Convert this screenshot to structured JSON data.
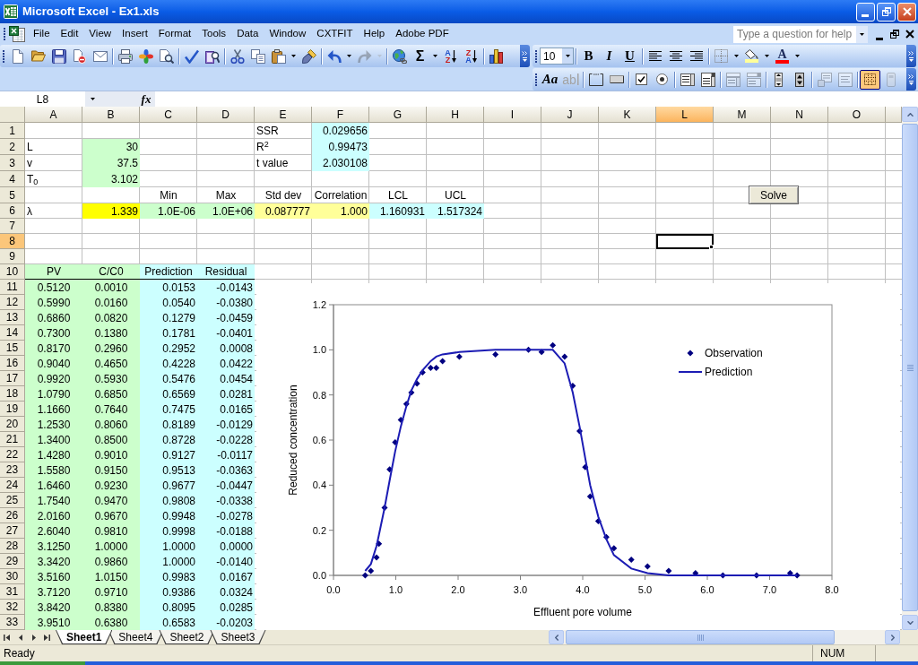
{
  "window": {
    "title": "Microsoft Excel - Ex1.xls"
  },
  "menu_bar": {
    "items": [
      "File",
      "Edit",
      "View",
      "Insert",
      "Format",
      "Tools",
      "Data",
      "Window",
      "CXTFIT",
      "Help",
      "Adobe PDF"
    ],
    "help_box": {
      "placeholder": "Type a question for help"
    }
  },
  "standard_toolbar": {
    "groups": [
      [
        {
          "kind": "new",
          "disabled": false
        },
        {
          "kind": "open",
          "disabled": false
        },
        {
          "kind": "save",
          "disabled": false
        },
        {
          "kind": "permission",
          "disabled": false
        },
        {
          "kind": "email",
          "disabled": false
        }
      ],
      [
        {
          "kind": "print",
          "disabled": false
        },
        {
          "kind": "star",
          "disabled": false
        },
        {
          "kind": "preview",
          "disabled": false
        }
      ],
      [
        {
          "kind": "spelling",
          "disabled": false
        },
        {
          "kind": "research",
          "disabled": false
        }
      ],
      [
        {
          "kind": "cut",
          "disabled": false
        },
        {
          "kind": "copy",
          "disabled": false
        },
        {
          "kind": "paste",
          "disabled": false
        },
        {
          "kind": "caret",
          "disabled": false
        },
        {
          "kind": "format_painter",
          "disabled": false
        }
      ],
      [
        {
          "kind": "undo",
          "disabled": false
        },
        {
          "kind": "caret",
          "disabled": false
        },
        {
          "kind": "redo",
          "disabled": true
        },
        {
          "kind": "caret",
          "disabled": true
        }
      ],
      [
        {
          "kind": "hyperlink",
          "disabled": false
        },
        {
          "kind": "autosum",
          "text": "Σ",
          "disabled": false
        },
        {
          "kind": "caret",
          "disabled": false
        },
        {
          "kind": "sort_ascending",
          "letters": [
            "A",
            "Z"
          ],
          "disabled": false
        },
        {
          "kind": "sort_descending",
          "letters": [
            "Z",
            "A"
          ],
          "disabled": false
        }
      ],
      [
        {
          "kind": "chart_wizard",
          "disabled": false
        }
      ]
    ]
  },
  "formatting_toolbar": {
    "font_size": "10",
    "groups": [
      [
        {
          "kind": "bold",
          "text": "B",
          "disabled": false
        },
        {
          "kind": "italic",
          "text": "I",
          "disabled": false
        },
        {
          "kind": "underline",
          "text": "U",
          "disabled": false
        }
      ],
      [
        {
          "kind": "align_left",
          "disabled": false
        },
        {
          "kind": "align_center",
          "disabled": false
        },
        {
          "kind": "align_right",
          "disabled": false
        }
      ],
      [
        {
          "kind": "borders",
          "disabled": false
        },
        {
          "kind": "caret",
          "disabled": false
        },
        {
          "kind": "fill_color",
          "color": "#ffff99",
          "disabled": false
        },
        {
          "kind": "caret",
          "disabled": false
        },
        {
          "kind": "font_color",
          "text": "A",
          "color": "#ff0000",
          "disabled": false
        },
        {
          "kind": "caret",
          "disabled": false
        }
      ]
    ]
  },
  "forms_toolbar": {
    "groups": [
      [
        {
          "kind": "label",
          "text": "Aa",
          "disabled": false
        },
        {
          "kind": "edit_box",
          "text": "ab",
          "disabled": true
        }
      ],
      [
        {
          "kind": "group_box",
          "disabled": false
        },
        {
          "kind": "push_button",
          "disabled": false
        }
      ],
      [
        {
          "kind": "checkbox",
          "disabled": false
        },
        {
          "kind": "option_button",
          "disabled": false
        }
      ],
      [
        {
          "kind": "list_box",
          "disabled": false
        },
        {
          "kind": "combo_box",
          "disabled": false
        }
      ],
      [
        {
          "kind": "combo_list_edit",
          "disabled": true
        },
        {
          "kind": "combo_drop_edit",
          "disabled": true
        }
      ],
      [
        {
          "kind": "scroll_bar",
          "disabled": false
        },
        {
          "kind": "spinner",
          "disabled": false
        }
      ],
      [
        {
          "kind": "control_properties",
          "disabled": true
        },
        {
          "kind": "edit_code",
          "disabled": true
        }
      ],
      [
        {
          "kind": "toggle_grid",
          "disabled": false,
          "pressed": true
        },
        {
          "kind": "run_dialog",
          "disabled": true
        }
      ]
    ]
  },
  "formula_bar": {
    "name_box": "L8",
    "function_label": "fx"
  },
  "sheet": {
    "columns": [
      {
        "label": "A",
        "selected": false
      },
      {
        "label": "B",
        "selected": false
      },
      {
        "label": "C",
        "selected": false
      },
      {
        "label": "D",
        "selected": false
      },
      {
        "label": "E",
        "selected": false
      },
      {
        "label": "F",
        "selected": false
      },
      {
        "label": "G",
        "selected": false
      },
      {
        "label": "H",
        "selected": false
      },
      {
        "label": "I",
        "selected": false
      },
      {
        "label": "J",
        "selected": false
      },
      {
        "label": "K",
        "selected": false
      },
      {
        "label": "L",
        "selected": true
      },
      {
        "label": "M",
        "selected": false
      },
      {
        "label": "N",
        "selected": false
      },
      {
        "label": "O",
        "selected": false
      }
    ],
    "rows": [
      {
        "header": "1",
        "selected": false,
        "cells": [
          {},
          {},
          {},
          {},
          {
            "text": "SSR",
            "kind": "text"
          },
          {
            "text": "0.029656",
            "kind": "number",
            "color": "#ccffff"
          }
        ]
      },
      {
        "header": "2",
        "selected": false,
        "cells": [
          {
            "text": "L",
            "kind": "text"
          },
          {
            "text": "30",
            "kind": "number",
            "color": "#ccffcc"
          },
          {},
          {},
          {
            "text": "R$^{2}$",
            "kind": "text"
          },
          {
            "text": "0.99473",
            "kind": "number",
            "color": "#ccffff"
          }
        ]
      },
      {
        "header": "3",
        "selected": false,
        "cells": [
          {
            "text": "v",
            "kind": "text"
          },
          {
            "text": "37.5",
            "kind": "number",
            "color": "#ccffcc"
          },
          {},
          {},
          {
            "text": "t value",
            "kind": "text"
          },
          {
            "text": "2.030108",
            "kind": "number",
            "color": "#ccffff"
          }
        ]
      },
      {
        "header": "4",
        "selected": false,
        "cells": [
          {
            "text": "T$_{0}$",
            "kind": "text"
          },
          {
            "text": "3.102",
            "kind": "number",
            "color": "#ccffcc"
          }
        ]
      },
      {
        "header": "5",
        "selected": false,
        "cells": [
          {},
          {},
          {
            "text": "Min",
            "kind": "center"
          },
          {
            "text": "Max",
            "kind": "center"
          },
          {
            "text": "Std dev",
            "kind": "center"
          },
          {
            "text": "Correlation",
            "kind": "center"
          },
          {
            "text": "LCL",
            "kind": "center"
          },
          {
            "text": "UCL",
            "kind": "center"
          }
        ]
      },
      {
        "header": "6",
        "selected": false,
        "cells": [
          {
            "text": "λ",
            "kind": "text"
          },
          {
            "text": "1.339",
            "kind": "number",
            "color": "#ffff00"
          },
          {
            "text": "1.0E-06",
            "kind": "number",
            "color": "#ccffcc"
          },
          {
            "text": "1.0E+06",
            "kind": "number",
            "color": "#ccffcc"
          },
          {
            "text": "0.087777",
            "kind": "number",
            "color": "#ffff99"
          },
          {
            "text": "1.000",
            "kind": "number",
            "color": "#ffff99"
          },
          {
            "text": "1.160931",
            "kind": "number",
            "color": "#ccffff"
          },
          {
            "text": "1.517324",
            "kind": "number",
            "color": "#ccffff"
          }
        ]
      },
      {
        "header": "7",
        "selected": false
      },
      {
        "header": "8",
        "selected": true
      },
      {
        "header": "9",
        "selected": false
      },
      {
        "header": "10",
        "selected": false,
        "cells": [
          {
            "text": "PV",
            "kind": "heading",
            "color": "#ccffcc"
          },
          {
            "text": "C/C0",
            "kind": "heading",
            "color": "#ccffcc"
          },
          {
            "text": "Prediction",
            "kind": "heading",
            "color": "#ccffff"
          },
          {
            "text": "Residual",
            "kind": "heading",
            "color": "#ccffff"
          }
        ]
      },
      {
        "header": "11",
        "selected": false,
        "cells": [
          {
            "text": "0.5120",
            "kind": "center",
            "color": "#ccffcc"
          },
          {
            "text": "0.0010",
            "kind": "center",
            "color": "#ccffcc"
          },
          {
            "text": "0.0153",
            "kind": "number",
            "color": "#ccffff"
          },
          {
            "text": "-0.0143",
            "kind": "number",
            "color": "#ccffff"
          }
        ]
      },
      {
        "header": "12",
        "selected": false,
        "cells": [
          {
            "text": "0.5990",
            "kind": "center",
            "color": "#ccffcc"
          },
          {
            "text": "0.0160",
            "kind": "center",
            "color": "#ccffcc"
          },
          {
            "text": "0.0540",
            "kind": "number",
            "color": "#ccffff"
          },
          {
            "text": "-0.0380",
            "kind": "number",
            "color": "#ccffff"
          }
        ]
      },
      {
        "header": "13",
        "selected": false,
        "cells": [
          {
            "text": "0.6860",
            "kind": "center",
            "color": "#ccffcc"
          },
          {
            "text": "0.0820",
            "kind": "center",
            "color": "#ccffcc"
          },
          {
            "text": "0.1279",
            "kind": "number",
            "color": "#ccffff"
          },
          {
            "text": "-0.0459",
            "kind": "number",
            "color": "#ccffff"
          }
        ]
      },
      {
        "header": "14",
        "selected": false,
        "cells": [
          {
            "text": "0.7300",
            "kind": "center",
            "color": "#ccffcc"
          },
          {
            "text": "0.1380",
            "kind": "center",
            "color": "#ccffcc"
          },
          {
            "text": "0.1781",
            "kind": "number",
            "color": "#ccffff"
          },
          {
            "text": "-0.0401",
            "kind": "number",
            "color": "#ccffff"
          }
        ]
      },
      {
        "header": "15",
        "selected": false,
        "cells": [
          {
            "text": "0.8170",
            "kind": "center",
            "color": "#ccffcc"
          },
          {
            "text": "0.2960",
            "kind": "center",
            "color": "#ccffcc"
          },
          {
            "text": "0.2952",
            "kind": "number",
            "color": "#ccffff"
          },
          {
            "text": "0.0008",
            "kind": "number",
            "color": "#ccffff"
          }
        ]
      },
      {
        "header": "16",
        "selected": false,
        "cells": [
          {
            "text": "0.9040",
            "kind": "center",
            "color": "#ccffcc"
          },
          {
            "text": "0.4650",
            "kind": "center",
            "color": "#ccffcc"
          },
          {
            "text": "0.4228",
            "kind": "number",
            "color": "#ccffff"
          },
          {
            "text": "0.0422",
            "kind": "number",
            "color": "#ccffff"
          }
        ]
      },
      {
        "header": "17",
        "selected": false,
        "cells": [
          {
            "text": "0.9920",
            "kind": "center",
            "color": "#ccffcc"
          },
          {
            "text": "0.5930",
            "kind": "center",
            "color": "#ccffcc"
          },
          {
            "text": "0.5476",
            "kind": "number",
            "color": "#ccffff"
          },
          {
            "text": "0.0454",
            "kind": "number",
            "color": "#ccffff"
          }
        ]
      },
      {
        "header": "18",
        "selected": false,
        "cells": [
          {
            "text": "1.0790",
            "kind": "center",
            "color": "#ccffcc"
          },
          {
            "text": "0.6850",
            "kind": "center",
            "color": "#ccffcc"
          },
          {
            "text": "0.6569",
            "kind": "number",
            "color": "#ccffff"
          },
          {
            "text": "0.0281",
            "kind": "number",
            "color": "#ccffff"
          }
        ]
      },
      {
        "header": "19",
        "selected": false,
        "cells": [
          {
            "text": "1.1660",
            "kind": "center",
            "color": "#ccffcc"
          },
          {
            "text": "0.7640",
            "kind": "center",
            "color": "#ccffcc"
          },
          {
            "text": "0.7475",
            "kind": "number",
            "color": "#ccffff"
          },
          {
            "text": "0.0165",
            "kind": "number",
            "color": "#ccffff"
          }
        ]
      },
      {
        "header": "20",
        "selected": false,
        "cells": [
          {
            "text": "1.2530",
            "kind": "center",
            "color": "#ccffcc"
          },
          {
            "text": "0.8060",
            "kind": "center",
            "color": "#ccffcc"
          },
          {
            "text": "0.8189",
            "kind": "number",
            "color": "#ccffff"
          },
          {
            "text": "-0.0129",
            "kind": "number",
            "color": "#ccffff"
          }
        ]
      },
      {
        "header": "21",
        "selected": false,
        "cells": [
          {
            "text": "1.3400",
            "kind": "center",
            "color": "#ccffcc"
          },
          {
            "text": "0.8500",
            "kind": "center",
            "color": "#ccffcc"
          },
          {
            "text": "0.8728",
            "kind": "number",
            "color": "#ccffff"
          },
          {
            "text": "-0.0228",
            "kind": "number",
            "color": "#ccffff"
          }
        ]
      },
      {
        "header": "22",
        "selected": false,
        "cells": [
          {
            "text": "1.4280",
            "kind": "center",
            "color": "#ccffcc"
          },
          {
            "text": "0.9010",
            "kind": "center",
            "color": "#ccffcc"
          },
          {
            "text": "0.9127",
            "kind": "number",
            "color": "#ccffff"
          },
          {
            "text": "-0.0117",
            "kind": "number",
            "color": "#ccffff"
          }
        ]
      },
      {
        "header": "23",
        "selected": false,
        "cells": [
          {
            "text": "1.5580",
            "kind": "center",
            "color": "#ccffcc"
          },
          {
            "text": "0.9150",
            "kind": "center",
            "color": "#ccffcc"
          },
          {
            "text": "0.9513",
            "kind": "number",
            "color": "#ccffff"
          },
          {
            "text": "-0.0363",
            "kind": "number",
            "color": "#ccffff"
          }
        ]
      },
      {
        "header": "24",
        "selected": false,
        "cells": [
          {
            "text": "1.6460",
            "kind": "center",
            "color": "#ccffcc"
          },
          {
            "text": "0.9230",
            "kind": "center",
            "color": "#ccffcc"
          },
          {
            "text": "0.9677",
            "kind": "number",
            "color": "#ccffff"
          },
          {
            "text": "-0.0447",
            "kind": "number",
            "color": "#ccffff"
          }
        ]
      },
      {
        "header": "25",
        "selected": false,
        "cells": [
          {
            "text": "1.7540",
            "kind": "center",
            "color": "#ccffcc"
          },
          {
            "text": "0.9470",
            "kind": "center",
            "color": "#ccffcc"
          },
          {
            "text": "0.9808",
            "kind": "number",
            "color": "#ccffff"
          },
          {
            "text": "-0.0338",
            "kind": "number",
            "color": "#ccffff"
          }
        ]
      },
      {
        "header": "26",
        "selected": false,
        "cells": [
          {
            "text": "2.0160",
            "kind": "center",
            "color": "#ccffcc"
          },
          {
            "text": "0.9670",
            "kind": "center",
            "color": "#ccffcc"
          },
          {
            "text": "0.9948",
            "kind": "number",
            "color": "#ccffff"
          },
          {
            "text": "-0.0278",
            "kind": "number",
            "color": "#ccffff"
          }
        ]
      },
      {
        "header": "27",
        "selected": false,
        "cells": [
          {
            "text": "2.6040",
            "kind": "center",
            "color": "#ccffcc"
          },
          {
            "text": "0.9810",
            "kind": "center",
            "color": "#ccffcc"
          },
          {
            "text": "0.9998",
            "kind": "number",
            "color": "#ccffff"
          },
          {
            "text": "-0.0188",
            "kind": "number",
            "color": "#ccffff"
          }
        ]
      },
      {
        "header": "28",
        "selected": false,
        "cells": [
          {
            "text": "3.1250",
            "kind": "center",
            "color": "#ccffcc"
          },
          {
            "text": "1.0000",
            "kind": "center",
            "color": "#ccffcc"
          },
          {
            "text": "1.0000",
            "kind": "number",
            "color": "#ccffff"
          },
          {
            "text": "0.0000",
            "kind": "number",
            "color": "#ccffff"
          }
        ]
      },
      {
        "header": "29",
        "selected": false,
        "cells": [
          {
            "text": "3.3420",
            "kind": "center",
            "color": "#ccffcc"
          },
          {
            "text": "0.9860",
            "kind": "center",
            "color": "#ccffcc"
          },
          {
            "text": "1.0000",
            "kind": "number",
            "color": "#ccffff"
          },
          {
            "text": "-0.0140",
            "kind": "number",
            "color": "#ccffff"
          }
        ]
      },
      {
        "header": "30",
        "selected": false,
        "cells": [
          {
            "text": "3.5160",
            "kind": "center",
            "color": "#ccffcc"
          },
          {
            "text": "1.0150",
            "kind": "center",
            "color": "#ccffcc"
          },
          {
            "text": "0.9983",
            "kind": "number",
            "color": "#ccffff"
          },
          {
            "text": "0.0167",
            "kind": "number",
            "color": "#ccffff"
          }
        ]
      },
      {
        "header": "31",
        "selected": false,
        "cells": [
          {
            "text": "3.7120",
            "kind": "center",
            "color": "#ccffcc"
          },
          {
            "text": "0.9710",
            "kind": "center",
            "color": "#ccffcc"
          },
          {
            "text": "0.9386",
            "kind": "number",
            "color": "#ccffff"
          },
          {
            "text": "0.0324",
            "kind": "number",
            "color": "#ccffff"
          }
        ]
      },
      {
        "header": "32",
        "selected": false,
        "cells": [
          {
            "text": "3.8420",
            "kind": "center",
            "color": "#ccffcc"
          },
          {
            "text": "0.8380",
            "kind": "center",
            "color": "#ccffcc"
          },
          {
            "text": "0.8095",
            "kind": "number",
            "color": "#ccffff"
          },
          {
            "text": "0.0285",
            "kind": "number",
            "color": "#ccffff"
          }
        ]
      },
      {
        "header": "33",
        "selected": false,
        "cells": [
          {
            "text": "3.9510",
            "kind": "center",
            "color": "#ccffcc"
          },
          {
            "text": "0.6380",
            "kind": "center",
            "color": "#ccffcc"
          },
          {
            "text": "0.6583",
            "kind": "number",
            "color": "#ccffff"
          },
          {
            "text": "-0.0203",
            "kind": "number",
            "color": "#ccffff"
          }
        ]
      }
    ]
  },
  "solve_button": {
    "label": "Solve"
  },
  "chart": {
    "chart_data": {
      "type": "scatter",
      "xlabel": "Effluent pore volume",
      "ylabel": "Reduced concentration",
      "x": [
        0.51,
        0.6,
        0.69,
        0.73,
        0.82,
        0.9,
        0.99,
        1.08,
        1.17,
        1.25,
        1.34,
        1.43,
        1.56,
        1.65,
        1.75,
        2.02,
        2.6,
        3.13,
        3.34,
        3.52,
        3.71,
        3.84,
        3.95,
        4.04,
        4.12,
        4.25,
        4.38,
        4.5,
        4.78,
        5.04,
        5.38,
        5.81,
        6.25,
        6.79,
        7.33,
        7.44
      ],
      "series": [
        {
          "name": "Observation",
          "type": "scatter",
          "color": "#000080",
          "values": [
            0.0,
            0.02,
            0.08,
            0.14,
            0.3,
            0.47,
            0.59,
            0.69,
            0.76,
            0.81,
            0.85,
            0.9,
            0.92,
            0.92,
            0.95,
            0.97,
            0.98,
            1.0,
            0.99,
            1.02,
            0.97,
            0.84,
            0.64,
            0.48,
            0.35,
            0.24,
            0.17,
            0.12,
            0.07,
            0.04,
            0.02,
            0.01,
            0.0,
            0.0,
            0.01,
            0.0
          ]
        },
        {
          "name": "Prediction",
          "type": "line",
          "color": "#1c1cb4",
          "values": [
            0.02,
            0.05,
            0.13,
            0.18,
            0.3,
            0.42,
            0.55,
            0.66,
            0.75,
            0.82,
            0.87,
            0.91,
            0.95,
            0.97,
            0.98,
            0.99,
            1.0,
            1.0,
            1.0,
            1.0,
            0.94,
            0.81,
            0.66,
            0.52,
            0.4,
            0.26,
            0.16,
            0.09,
            0.03,
            0.01,
            0.0,
            0.0,
            0.0,
            0.0,
            0.0,
            0.0
          ]
        }
      ],
      "xlim": [
        0,
        8
      ],
      "ylim": [
        0,
        1.2
      ],
      "xticks": [
        {
          "value": 0,
          "label": "0.0"
        },
        {
          "value": 1,
          "label": "1.0"
        },
        {
          "value": 2,
          "label": "2.0"
        },
        {
          "value": 3,
          "label": "3.0"
        },
        {
          "value": 4,
          "label": "4.0"
        },
        {
          "value": 5,
          "label": "5.0"
        },
        {
          "value": 6,
          "label": "6.0"
        },
        {
          "value": 7,
          "label": "7.0"
        },
        {
          "value": 8,
          "label": "8.0"
        }
      ],
      "yticks": [
        {
          "value": 0,
          "label": "0.0"
        },
        {
          "value": 0.2,
          "label": "0.2"
        },
        {
          "value": 0.4,
          "label": "0.4"
        },
        {
          "value": 0.6,
          "label": "0.6"
        },
        {
          "value": 0.8,
          "label": "0.8"
        },
        {
          "value": 1.0,
          "label": "1.0"
        },
        {
          "value": 1.2,
          "label": "1.2"
        }
      ],
      "legend": "upper right"
    }
  },
  "sheet_tabs": [
    {
      "label": "Sheet1",
      "selected": true
    },
    {
      "label": "Sheet4",
      "selected": false
    },
    {
      "label": "Sheet2",
      "selected": false
    },
    {
      "label": "Sheet3",
      "selected": false
    }
  ],
  "status_bar": {
    "status": "Ready",
    "indicators": [
      "NUM"
    ]
  }
}
